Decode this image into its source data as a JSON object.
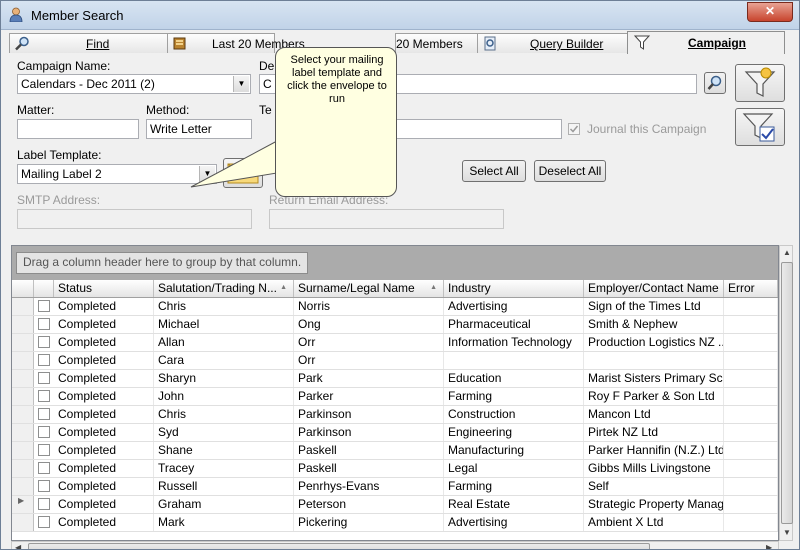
{
  "window": {
    "title": "Member Search",
    "close_label": "✕"
  },
  "tabs": [
    {
      "label": "Find",
      "icon": "magnifier-icon"
    },
    {
      "label": "Last 20 Members",
      "icon": "book-icon"
    },
    {
      "label": "20 Members",
      "icon": ""
    },
    {
      "label": "Query Builder",
      "icon": "query-icon"
    },
    {
      "label": "Campaign",
      "icon": "funnel-icon"
    }
  ],
  "form": {
    "campaign_name_label": "Campaign Name:",
    "campaign_name_value": "Calendars - Dec 2011 (2)",
    "description_label_partial": "De",
    "description_value_partial": "C",
    "matter_label": "Matter:",
    "matter_value": "",
    "method_label": "Method:",
    "method_value": "Write Letter",
    "template_label_partial": "Te",
    "journal_label": "Journal this Campaign",
    "label_template_label": "Label Template:",
    "label_template_value": "Mailing Label 2",
    "smtp_label": "SMTP Address:",
    "smtp_value": "",
    "return_email_label": "Return Email Address:",
    "return_email_value": "",
    "select_all": "Select All",
    "deselect_all": "Deselect All"
  },
  "tooltip": {
    "text": "Select your mailing label template and click the envelope to run"
  },
  "grid": {
    "group_hint": "Drag a column header here to group by that column.",
    "columns": [
      "Status",
      "Salutation/Trading N...",
      "Surname/Legal Name",
      "Industry",
      "Employer/Contact Name",
      "Error"
    ],
    "rows": [
      [
        "Completed",
        "Chris",
        "Norris",
        "Advertising",
        "Sign of the Times Ltd",
        ""
      ],
      [
        "Completed",
        "Michael",
        "Ong",
        "Pharmaceutical",
        "Smith & Nephew",
        ""
      ],
      [
        "Completed",
        "Allan",
        "Orr",
        "Information Technology",
        "Production Logistics NZ ...",
        ""
      ],
      [
        "Completed",
        "Cara",
        "Orr",
        "",
        "",
        ""
      ],
      [
        "Completed",
        "Sharyn",
        "Park",
        "Education",
        "Marist Sisters Primary Sch...",
        ""
      ],
      [
        "Completed",
        "John",
        "Parker",
        "Farming",
        "Roy F Parker & Son Ltd",
        ""
      ],
      [
        "Completed",
        "Chris",
        "Parkinson",
        "Construction",
        "Mancon Ltd",
        ""
      ],
      [
        "Completed",
        "Syd",
        "Parkinson",
        "Engineering",
        "Pirtek NZ Ltd",
        ""
      ],
      [
        "Completed",
        "Shane",
        "Paskell",
        "Manufacturing",
        "Parker Hannifin (N.Z.) Ltd",
        ""
      ],
      [
        "Completed",
        "Tracey",
        "Paskell",
        "Legal",
        "Gibbs Mills Livingstone",
        ""
      ],
      [
        "Completed",
        "Russell",
        "Penrhys-Evans",
        "Farming",
        "Self",
        ""
      ],
      [
        "Completed",
        "Graham",
        "Peterson",
        "Real Estate",
        "Strategic Property Manag...",
        ""
      ],
      [
        "Completed",
        "Mark",
        "Pickering",
        "Advertising",
        "Ambient X Ltd",
        ""
      ]
    ]
  },
  "colors": {
    "tooltip_bg": "#ffffe1",
    "group_panel": "#ababab",
    "close_red": "#c8442d"
  }
}
